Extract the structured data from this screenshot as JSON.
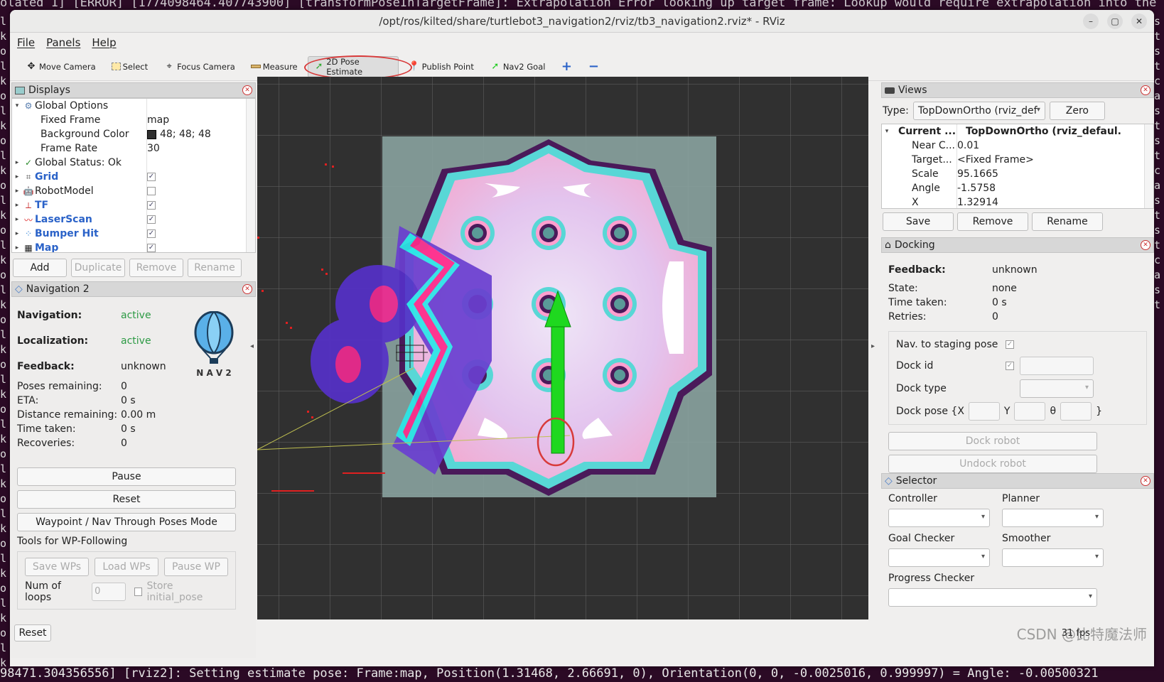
{
  "terminal": {
    "top_line": "olated 1] [ERROR] [1774098464.407743900] [transformPoseInTargetFrame]: Extrapolation Error looking up target frame: Lookup would require extrapolation into the past",
    "bottom_line": "98471.304356556] [rviz2]: Setting estimate pose: Frame:map, Position(1.31468, 2.66691, 0), Orientation(0, 0, -0.0025016, 0.999997) = Angle: -0.00500321",
    "left_chars": "lkolkolkolkolkolkolkolkolkolkolkolkolkolkolko",
    "right_chars": "st st ca st st ca st st ca st"
  },
  "window": {
    "title": "/opt/ros/kilted/share/turtlebot3_navigation2/rviz/tb3_navigation2.rviz* - RViz",
    "min_icon": "–",
    "max_icon": "▢",
    "close_icon": "✕"
  },
  "menu": [
    "File",
    "Panels",
    "Help"
  ],
  "toolbar": {
    "move_camera": "Move Camera",
    "select": "Select",
    "focus_camera": "Focus Camera",
    "measure": "Measure",
    "pose_estimate": "2D Pose Estimate",
    "publish_point": "Publish Point",
    "nav2_goal": "Nav2 Goal",
    "plus": "+",
    "minus": "−"
  },
  "displays": {
    "title": "Displays",
    "global_options": "Global Options",
    "fixed_frame_label": "Fixed Frame",
    "fixed_frame": "map",
    "bg_label": "Background Color",
    "bg_value": "48; 48; 48",
    "bg_swatch": "#303030",
    "frame_rate_label": "Frame Rate",
    "frame_rate": "30",
    "global_status": "Global Status: Ok",
    "items": [
      {
        "label": "Grid",
        "checked": true,
        "blue": true
      },
      {
        "label": "RobotModel",
        "checked": false,
        "blue": false
      },
      {
        "label": "TF",
        "checked": true,
        "blue": true
      },
      {
        "label": "LaserScan",
        "checked": true,
        "blue": true
      },
      {
        "label": "Bumper Hit",
        "checked": true,
        "blue": true
      },
      {
        "label": "Map",
        "checked": true,
        "blue": true
      }
    ],
    "add": "Add",
    "duplicate": "Duplicate",
    "remove": "Remove",
    "rename": "Rename"
  },
  "nav2": {
    "title": "Navigation 2",
    "navigation_label": "Navigation:",
    "navigation": "active",
    "localization_label": "Localization:",
    "localization": "active",
    "feedback_label": "Feedback:",
    "feedback": "unknown",
    "poses_label": "Poses remaining:",
    "poses": "0",
    "eta_label": "ETA:",
    "eta": "0 s",
    "dist_label": "Distance remaining:",
    "dist": "0.00 m",
    "time_label": "Time taken:",
    "time": "0 s",
    "recov_label": "Recoveries:",
    "recov": "0",
    "logo_text": "N A V 2",
    "pause": "Pause",
    "reset": "Reset",
    "waypoint": "Waypoint / Nav Through Poses Mode",
    "tools_label": "Tools for WP-Following",
    "save_wps": "Save WPs",
    "load_wps": "Load WPs",
    "pause_wp": "Pause WP",
    "loops_label": "Num of loops",
    "loops_placeholder": "0",
    "store_initial": "Store initial_pose"
  },
  "views": {
    "title": "Views",
    "type_label": "Type:",
    "type_value": "TopDownOrtho (rviz_def",
    "zero": "Zero",
    "current_label": "Current ...",
    "current_value": "TopDownOrtho (rviz_defaul.",
    "props": [
      {
        "k": "Near C...",
        "v": "0.01"
      },
      {
        "k": "Target...",
        "v": "<Fixed Frame>"
      },
      {
        "k": "Scale",
        "v": "95.1665"
      },
      {
        "k": "Angle",
        "v": "-1.5758"
      },
      {
        "k": "X",
        "v": "1.32914"
      }
    ],
    "save": "Save",
    "remove": "Remove",
    "rename": "Rename"
  },
  "docking": {
    "title": "Docking",
    "feedback_label": "Feedback:",
    "feedback": "unknown",
    "state_label": "State:",
    "state": "none",
    "time_label": "Time taken:",
    "time": "0 s",
    "retries_label": "Retries:",
    "retries": "0",
    "staging_label": "Nav. to staging pose",
    "dock_id_label": "Dock id",
    "dock_type_label": "Dock type",
    "dock_pose_label": "Dock pose {X",
    "y_label": "Y",
    "theta_label": "θ",
    "close_brace": "}",
    "dock_robot": "Dock robot",
    "undock_robot": "Undock robot"
  },
  "selector": {
    "title": "Selector",
    "controller": "Controller",
    "planner": "Planner",
    "goal_checker": "Goal Checker",
    "smoother": "Smoother",
    "progress_checker": "Progress Checker"
  },
  "status": {
    "reset": "Reset",
    "fps": "31 fps",
    "watermark": "CSDN @比特魔法师"
  },
  "colors": {
    "accent_red": "#d83a3a",
    "active_green": "#2c9a44",
    "link_blue": "#2a62c8",
    "goal_arrow": "#1fd81f"
  }
}
